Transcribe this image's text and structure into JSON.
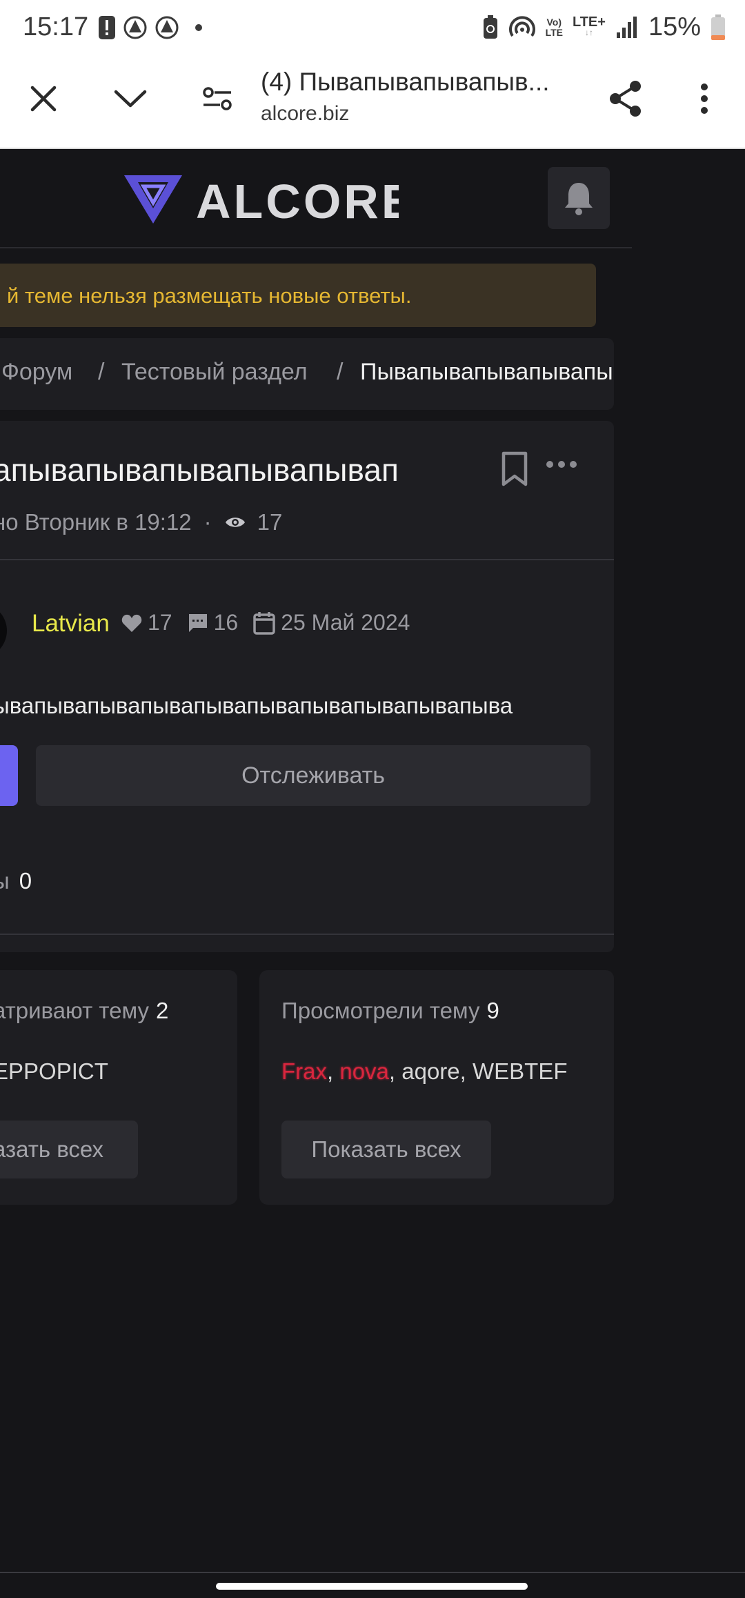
{
  "status_bar": {
    "time": "15:17",
    "battery": "15%",
    "network_label_top": "Vo)",
    "network_label_bottom": "LTE",
    "lte_label": "LTE+",
    "icons": [
      "alert-icon",
      "app-icon",
      "app-icon",
      "dot-icon",
      "battery-saver-icon",
      "hotspot-icon",
      "signal-icon",
      "battery-icon"
    ]
  },
  "browser": {
    "tab_title": "(4) Пывапывапывапыв...",
    "url": "alcore.biz",
    "icons": [
      "close-icon",
      "chevron-down-icon",
      "site-settings-icon",
      "share-icon",
      "more-vertical-icon"
    ]
  },
  "site": {
    "logo_text": "ALCORE",
    "notice": "й теме нельзя размещать новые ответы.",
    "breadcrumbs": [
      {
        "label": "Форум"
      },
      {
        "label": "Тестовый раздел"
      },
      {
        "label": "Пывапывапывапывапывап"
      }
    ],
    "topic": {
      "title": "апывапывапывапывапывап",
      "meta_date": "но Вторник в 19:12",
      "meta_dot": "·",
      "views": "17",
      "author": "Latvian",
      "likes": "17",
      "messages": "16",
      "registered": "25 Май 2024",
      "body": "ывапывапывапывапывапывапывапывапывапыва",
      "follow_label": "Отслеживать",
      "replies_label": "ы",
      "replies_count": "0"
    },
    "viewing_now": {
      "title": "атривают тему",
      "count": "2",
      "users": "EPPOPICT",
      "show_all": "азать всех"
    },
    "viewed": {
      "title": "Просмотрели тему",
      "count": "9",
      "users": [
        {
          "name": "Frax",
          "color": "#d9263e"
        },
        {
          "name": "nova",
          "color": "#d9263e"
        },
        {
          "name": "aqore",
          "color": "#d8d8d8"
        },
        {
          "name": "WEBTEF",
          "color": "#d8d8d8"
        }
      ],
      "separator": ", ",
      "show_all": "Показать всех"
    }
  }
}
